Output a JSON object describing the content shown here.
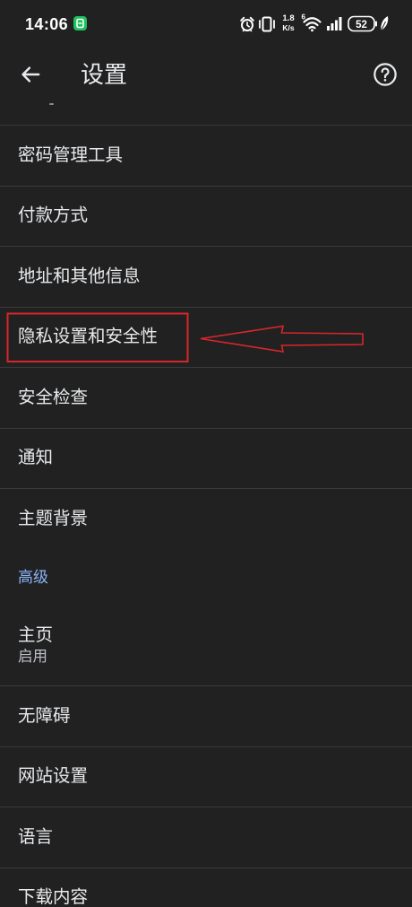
{
  "status_bar": {
    "time": "14:06",
    "net_speed": "1.8",
    "net_speed_unit": "K/s",
    "wifi_generation": "6",
    "battery_level": "52",
    "icons": [
      "app-notification-icon",
      "alarm-icon",
      "vibrate-icon",
      "wifi-icon",
      "signal-icon",
      "battery-icon",
      "leaf-icon"
    ]
  },
  "header": {
    "title": "设置",
    "back_icon": "arrow-back-icon",
    "help_icon": "help-circle-icon"
  },
  "settings_list": {
    "items": [
      {
        "label": "密码管理工具"
      },
      {
        "label": "付款方式"
      },
      {
        "label": "地址和其他信息"
      },
      {
        "label": "隐私设置和安全性"
      },
      {
        "label": "安全检查"
      },
      {
        "label": "通知"
      },
      {
        "label": "主题背景"
      }
    ]
  },
  "advanced_section": {
    "header": "高级",
    "items": [
      {
        "label": "主页",
        "sublabel": "启用"
      },
      {
        "label": "无障碍"
      },
      {
        "label": "网站设置"
      },
      {
        "label": "语言"
      },
      {
        "label": "下载内容"
      }
    ]
  },
  "colors": {
    "background": "#212121",
    "text": "#e8eaed",
    "secondary_text": "#bdc1c6",
    "accent": "#8ab4f8",
    "divider": "#3a3a3a",
    "annotation": "#d7262b",
    "app_icon": "#1fc15e"
  }
}
